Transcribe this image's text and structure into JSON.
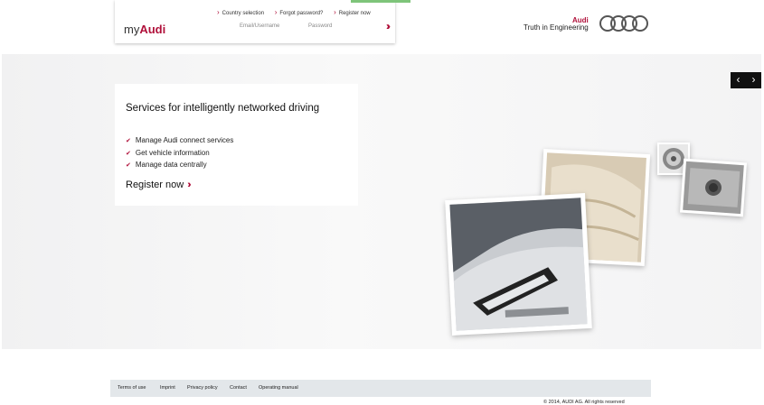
{
  "header": {
    "brand_prefix": "my",
    "brand_name": "Audi",
    "links": [
      "Country selection",
      "Forgot password?",
      "Register now"
    ],
    "email_placeholder": "Email/Username",
    "password_placeholder": "Password",
    "tagline_brand": "Audi",
    "tagline": "Truth in Engineering"
  },
  "hero": {
    "title": "Services for intelligently networked driving",
    "features": [
      "Manage Audi connect services",
      "Get vehicle information",
      "Manage data centrally"
    ],
    "cta": "Register now",
    "slider_prev": "‹",
    "slider_next": "›"
  },
  "footer": {
    "links": [
      "Terms of use",
      "Imprint",
      "Privacy policy",
      "Contact",
      "Operating manual"
    ],
    "copyright": "© 2014, AUDI AG. All rights reserved"
  },
  "colors": {
    "accent": "#b0103a",
    "footer_bg": "#e3e7ea"
  }
}
